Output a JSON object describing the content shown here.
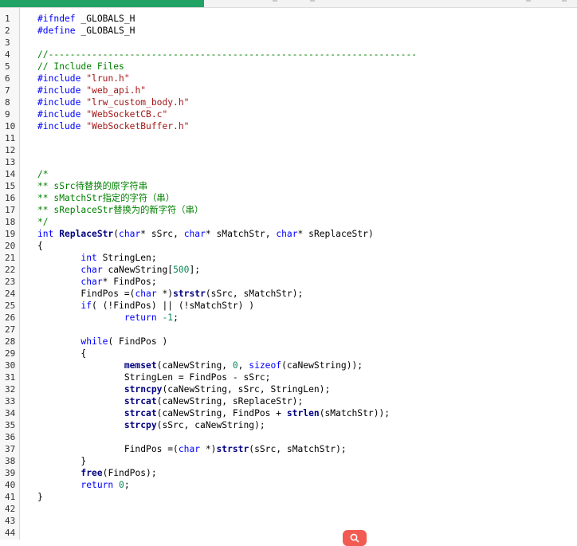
{
  "editor": {
    "lines": [
      {
        "n": "1",
        "tokens": [
          {
            "t": "#ifndef",
            "c": "pre"
          },
          {
            "t": " _GLOBALS_H"
          }
        ]
      },
      {
        "n": "2",
        "tokens": [
          {
            "t": "#define",
            "c": "pre"
          },
          {
            "t": " _GLOBALS_H"
          }
        ]
      },
      {
        "n": "3",
        "tokens": []
      },
      {
        "n": "4",
        "tokens": [
          {
            "t": "//--------------------------------------------------------------------",
            "c": "cmt"
          }
        ]
      },
      {
        "n": "5",
        "tokens": [
          {
            "t": "// Include Files",
            "c": "cmt"
          }
        ]
      },
      {
        "n": "6",
        "tokens": [
          {
            "t": "#include",
            "c": "pre"
          },
          {
            "t": " "
          },
          {
            "t": "\"lrun.h\"",
            "c": "str"
          }
        ]
      },
      {
        "n": "7",
        "tokens": [
          {
            "t": "#include",
            "c": "pre"
          },
          {
            "t": " "
          },
          {
            "t": "\"web_api.h\"",
            "c": "str"
          }
        ]
      },
      {
        "n": "8",
        "tokens": [
          {
            "t": "#include",
            "c": "pre"
          },
          {
            "t": " "
          },
          {
            "t": "\"lrw_custom_body.h\"",
            "c": "str"
          }
        ]
      },
      {
        "n": "9",
        "tokens": [
          {
            "t": "#include",
            "c": "pre"
          },
          {
            "t": " "
          },
          {
            "t": "\"WebSocketCB.c\"",
            "c": "str"
          }
        ]
      },
      {
        "n": "10",
        "tokens": [
          {
            "t": "#include",
            "c": "pre"
          },
          {
            "t": " "
          },
          {
            "t": "\"WebSocketBuffer.h\"",
            "c": "str"
          }
        ]
      },
      {
        "n": "11",
        "tokens": []
      },
      {
        "n": "12",
        "tokens": []
      },
      {
        "n": "13",
        "tokens": []
      },
      {
        "n": "14",
        "tokens": [
          {
            "t": "/*",
            "c": "cmt"
          }
        ]
      },
      {
        "n": "15",
        "tokens": [
          {
            "t": "** sSrc待替换的原字符串",
            "c": "cmt"
          }
        ]
      },
      {
        "n": "16",
        "tokens": [
          {
            "t": "** sMatchStr指定的字符（串）",
            "c": "cmt"
          }
        ]
      },
      {
        "n": "17",
        "tokens": [
          {
            "t": "** sReplaceStr替换为的新字符（串）",
            "c": "cmt"
          }
        ]
      },
      {
        "n": "18",
        "tokens": [
          {
            "t": "*/",
            "c": "cmt"
          }
        ]
      },
      {
        "n": "19",
        "tokens": [
          {
            "t": "int",
            "c": "kw"
          },
          {
            "t": " "
          },
          {
            "t": "ReplaceStr",
            "c": "fn"
          },
          {
            "t": "("
          },
          {
            "t": "char",
            "c": "kw"
          },
          {
            "t": "* sSrc, "
          },
          {
            "t": "char",
            "c": "kw"
          },
          {
            "t": "* sMatchStr, "
          },
          {
            "t": "char",
            "c": "kw"
          },
          {
            "t": "* sReplaceStr)"
          }
        ]
      },
      {
        "n": "20",
        "tokens": [
          {
            "t": "{"
          }
        ]
      },
      {
        "n": "21",
        "tokens": [
          {
            "t": "        "
          },
          {
            "t": "int",
            "c": "kw"
          },
          {
            "t": " StringLen;"
          }
        ]
      },
      {
        "n": "22",
        "tokens": [
          {
            "t": "        "
          },
          {
            "t": "char",
            "c": "kw"
          },
          {
            "t": " caNewString["
          },
          {
            "t": "500",
            "c": "num"
          },
          {
            "t": "];"
          }
        ]
      },
      {
        "n": "23",
        "tokens": [
          {
            "t": "        "
          },
          {
            "t": "char",
            "c": "kw"
          },
          {
            "t": "* FindPos;"
          }
        ]
      },
      {
        "n": "24",
        "tokens": [
          {
            "t": "        FindPos =("
          },
          {
            "t": "char",
            "c": "kw"
          },
          {
            "t": " *)"
          },
          {
            "t": "strstr",
            "c": "fn"
          },
          {
            "t": "(sSrc, sMatchStr);"
          }
        ]
      },
      {
        "n": "25",
        "tokens": [
          {
            "t": "        "
          },
          {
            "t": "if",
            "c": "kw"
          },
          {
            "t": "( (!FindPos) || (!sMatchStr) )"
          }
        ]
      },
      {
        "n": "26",
        "tokens": [
          {
            "t": "                "
          },
          {
            "t": "return",
            "c": "kw"
          },
          {
            "t": " "
          },
          {
            "t": "-1",
            "c": "num"
          },
          {
            "t": ";"
          }
        ]
      },
      {
        "n": "27",
        "tokens": []
      },
      {
        "n": "28",
        "tokens": [
          {
            "t": "        "
          },
          {
            "t": "while",
            "c": "kw"
          },
          {
            "t": "( FindPos )"
          }
        ]
      },
      {
        "n": "29",
        "tokens": [
          {
            "t": "        {"
          }
        ]
      },
      {
        "n": "30",
        "tokens": [
          {
            "t": "                "
          },
          {
            "t": "memset",
            "c": "fn"
          },
          {
            "t": "(caNewString, "
          },
          {
            "t": "0",
            "c": "num"
          },
          {
            "t": ", "
          },
          {
            "t": "sizeof",
            "c": "kw"
          },
          {
            "t": "(caNewString));"
          }
        ]
      },
      {
        "n": "31",
        "tokens": [
          {
            "t": "                StringLen = FindPos - sSrc;"
          }
        ]
      },
      {
        "n": "32",
        "tokens": [
          {
            "t": "                "
          },
          {
            "t": "strncpy",
            "c": "fn"
          },
          {
            "t": "(caNewString, sSrc, StringLen);"
          }
        ]
      },
      {
        "n": "33",
        "tokens": [
          {
            "t": "                "
          },
          {
            "t": "strcat",
            "c": "fn"
          },
          {
            "t": "(caNewString, sReplaceStr);"
          }
        ]
      },
      {
        "n": "34",
        "tokens": [
          {
            "t": "                "
          },
          {
            "t": "strcat",
            "c": "fn"
          },
          {
            "t": "(caNewString, FindPos + "
          },
          {
            "t": "strlen",
            "c": "fn"
          },
          {
            "t": "(sMatchStr));"
          }
        ]
      },
      {
        "n": "35",
        "tokens": [
          {
            "t": "                "
          },
          {
            "t": "strcpy",
            "c": "fn"
          },
          {
            "t": "(sSrc, caNewString);"
          }
        ]
      },
      {
        "n": "36",
        "tokens": []
      },
      {
        "n": "37",
        "tokens": [
          {
            "t": "                FindPos =("
          },
          {
            "t": "char",
            "c": "kw"
          },
          {
            "t": " *)"
          },
          {
            "t": "strstr",
            "c": "fn"
          },
          {
            "t": "(sSrc, sMatchStr);"
          }
        ]
      },
      {
        "n": "38",
        "tokens": [
          {
            "t": "        }"
          }
        ]
      },
      {
        "n": "39",
        "tokens": [
          {
            "t": "        "
          },
          {
            "t": "free",
            "c": "fn"
          },
          {
            "t": "(FindPos);"
          }
        ]
      },
      {
        "n": "40",
        "tokens": [
          {
            "t": "        "
          },
          {
            "t": "return",
            "c": "kw"
          },
          {
            "t": " "
          },
          {
            "t": "0",
            "c": "num"
          },
          {
            "t": ";"
          }
        ]
      },
      {
        "n": "41",
        "tokens": [
          {
            "t": "}"
          }
        ]
      },
      {
        "n": "42",
        "tokens": []
      },
      {
        "n": "43",
        "tokens": []
      },
      {
        "n": "44",
        "tokens": []
      }
    ]
  },
  "colors": {
    "accent_tab": "#21a366",
    "keyword": "#0000ff",
    "function": "#000080",
    "string": "#a31515",
    "number": "#098658",
    "comment": "#008000",
    "fab": "#f25b52"
  },
  "icons": {
    "floating_button": "search-icon"
  }
}
